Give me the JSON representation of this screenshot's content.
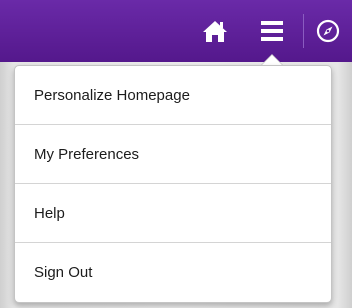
{
  "header": {
    "icons": [
      "home-icon",
      "hamburger-menu-icon",
      "navigator-compass-icon"
    ],
    "color": "#5e1f9a"
  },
  "menu": {
    "items": [
      {
        "label": "Personalize Homepage"
      },
      {
        "label": "My Preferences"
      },
      {
        "label": "Help"
      },
      {
        "label": "Sign Out"
      }
    ]
  }
}
